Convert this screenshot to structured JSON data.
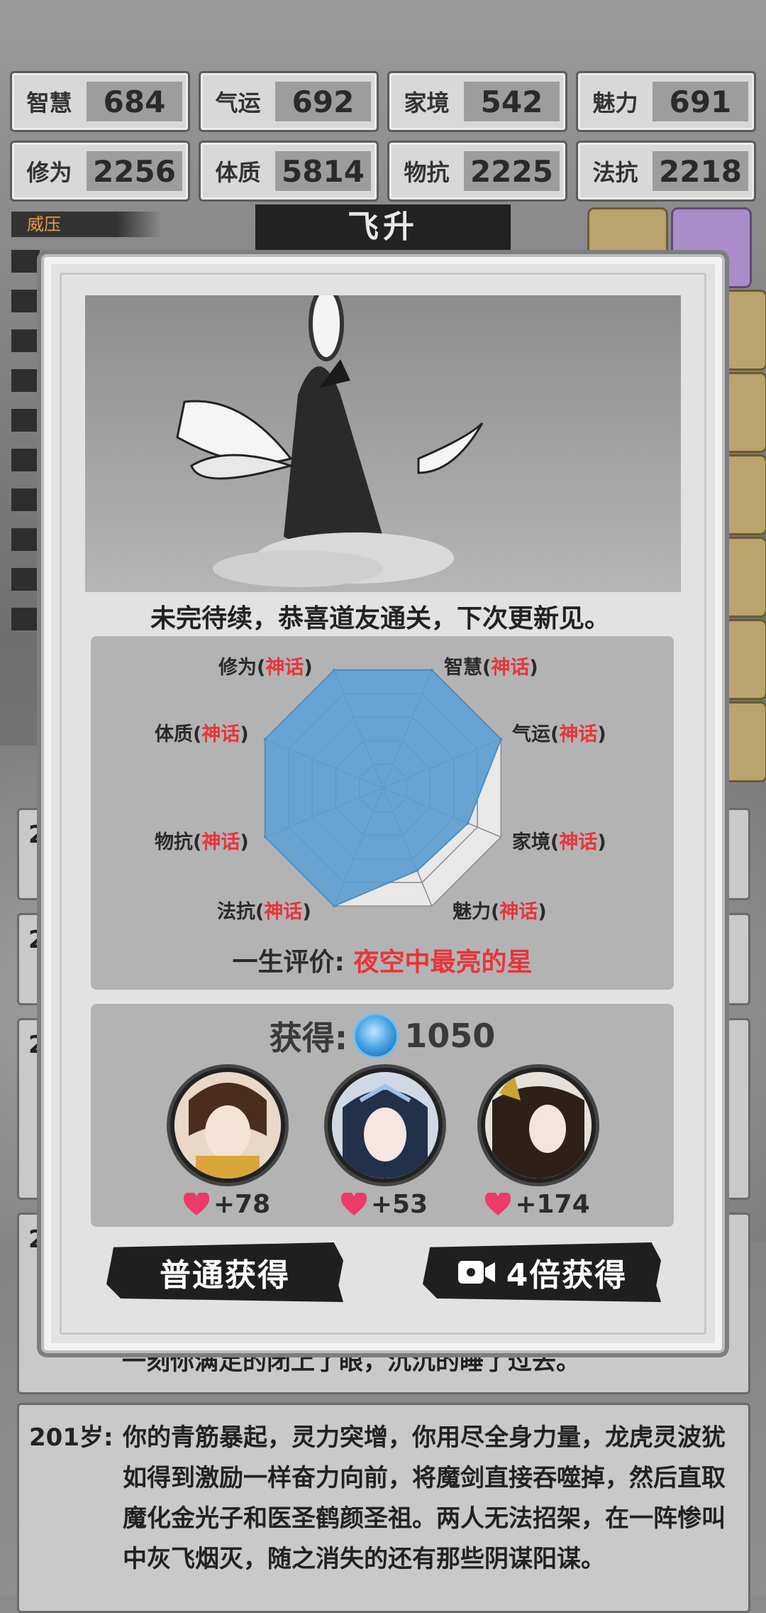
{
  "stats": [
    {
      "label": "智慧",
      "value": "684"
    },
    {
      "label": "气运",
      "value": "692"
    },
    {
      "label": "家境",
      "value": "542"
    },
    {
      "label": "魅力",
      "value": "691"
    },
    {
      "label": "修为",
      "value": "2256"
    },
    {
      "label": "体质",
      "value": "5814"
    },
    {
      "label": "物抗",
      "value": "2225"
    },
    {
      "label": "法抗",
      "value": "2218"
    }
  ],
  "tag_label": "威压",
  "banner_title": "飞升",
  "modal": {
    "message": "未完待续，恭喜道友通关，下次更新见。",
    "radar": {
      "labels": [
        {
          "name": "修为",
          "grade": "神话"
        },
        {
          "name": "智慧",
          "grade": "神话"
        },
        {
          "name": "气运",
          "grade": "神话"
        },
        {
          "name": "家境",
          "grade": "神话"
        },
        {
          "name": "魅力",
          "grade": "神话"
        },
        {
          "name": "法抗",
          "grade": "神话"
        },
        {
          "name": "物抗",
          "grade": "神话"
        },
        {
          "name": "体质",
          "grade": "神话"
        }
      ],
      "values": [
        1.0,
        1.0,
        1.0,
        0.72,
        0.7,
        1.0,
        1.0,
        1.0
      ],
      "fill": "#5b9bcf",
      "eval_label": "一生评价:",
      "eval_value": "夜空中最亮的星"
    },
    "reward": {
      "gain_label": "获得:",
      "gain_amount": "1050",
      "companions": [
        {
          "favor": "+78"
        },
        {
          "favor": "+53"
        },
        {
          "favor": "+174"
        }
      ]
    },
    "buttons": {
      "normal": "普通获得",
      "video": "4倍获得"
    }
  },
  "log": {
    "partial_line": "一刻你满足的闭上了眼，沉沉的睡了过去。",
    "entry_age": "201岁:",
    "entry_text": "你的青筋暴起，灵力突增，你用尽全身力量，龙虎灵波犹如得到激励一样奋力向前，将魔剑直接吞噬掉，然后直取魔化金光子和医圣鹤颜圣祖。两人无法招架，在一阵惨叫中灰飞烟灭，随之消失的还有那些阴谋阳谋。",
    "hidden_age_prefix": "2"
  }
}
